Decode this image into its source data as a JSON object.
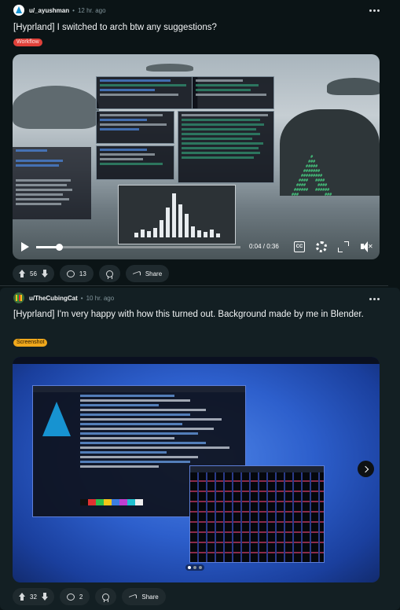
{
  "posts": [
    {
      "username": "u/_ayushman",
      "time": "12 hr. ago",
      "title": "[Hyprland] I switched to arch btw any suggestions?",
      "flair": "Workflow",
      "video": {
        "time_display": "0:04 / 0:36",
        "progress": 0.11,
        "cc_label": "CC"
      },
      "votes": "56",
      "comments": "13",
      "share_label": "Share"
    },
    {
      "username": "u/TheCubingCat",
      "time": "10 hr. ago",
      "title": "[Hyprland] I'm very happy with how this turned out. Background made by me in Blender.",
      "flair": "Screenshot",
      "gallery": {
        "total": 3,
        "current": 1
      },
      "votes": "32",
      "comments": "2",
      "share_label": "Share"
    }
  ],
  "separator": "•",
  "colors": {
    "flair_workflow": "#e0413a",
    "flair_screenshot": "#f0a81c",
    "background": "#0b1416",
    "pill": "#1f2a2e"
  },
  "icons": [
    "arch-avatar-icon",
    "cube-avatar-icon",
    "more-icon",
    "play-icon",
    "cc-icon",
    "settings-icon",
    "fullscreen-icon",
    "mute-icon",
    "upvote-icon",
    "downvote-icon",
    "comment-icon",
    "award-icon",
    "share-icon",
    "chevron-right-icon"
  ]
}
